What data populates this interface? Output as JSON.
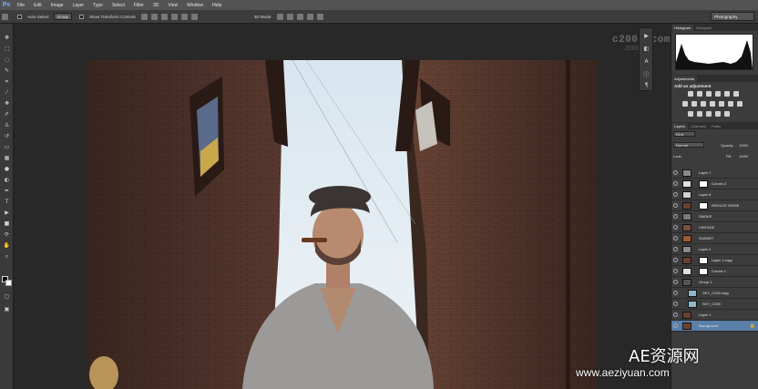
{
  "app": {
    "logo": "Ps",
    "menu": [
      "File",
      "Edit",
      "Image",
      "Layer",
      "Type",
      "Select",
      "Filter",
      "3D",
      "View",
      "Window",
      "Help"
    ]
  },
  "options": {
    "auto_select": "Auto-Select:",
    "group": "Group",
    "transform": "Show Transform Controls",
    "mode3d": "3D Mode:",
    "workspace": "Photography"
  },
  "watermark": {
    "line1": "c2000.com",
    "line2": "2000.net",
    "brand": "AE资源网",
    "url": "www.aeziyuan.com"
  },
  "panels": {
    "histogram_tab": "Histogram",
    "navigator_tab": "Navigator",
    "adjustments_tab": "Adjustments",
    "adjust_title": "Add an adjustment",
    "layers_tab": "Layers",
    "channels_tab": "Channels",
    "paths_tab": "Paths",
    "kind": "Kind",
    "blend": "Normal",
    "opacity_label": "Opacity:",
    "opacity_value": "100%",
    "lock_label": "Lock:",
    "fill_label": "Fill:",
    "fill_value": "100%"
  },
  "layers": [
    {
      "name": "Layer 7",
      "mask": false,
      "thumb": "#8a8a8a"
    },
    {
      "name": "Curves 2",
      "mask": true,
      "thumb": "#e0e0e0"
    },
    {
      "name": "Layer 6",
      "mask": false,
      "thumb": "#d0d0d0"
    },
    {
      "name": "REDUCE NOISE",
      "mask": true,
      "thumb": "#6b4030"
    },
    {
      "name": "SMOKE",
      "mask": false,
      "thumb": "#7a7a7a"
    },
    {
      "name": "VINTAGE",
      "mask": false,
      "thumb": "#7a5040"
    },
    {
      "name": "SUNSET",
      "mask": false,
      "thumb": "#a05a30"
    },
    {
      "name": "Layer 2",
      "mask": false,
      "thumb": "#8a8a8a"
    },
    {
      "name": "Layer 1 copy",
      "mask": true,
      "thumb": "#6b4030"
    },
    {
      "name": "Curves 1",
      "mask": true,
      "thumb": "#e0e0e0"
    },
    {
      "name": "Group 1",
      "mask": false,
      "thumb": "#555"
    },
    {
      "name": "SKY_COM copy",
      "mask": false,
      "thumb": "#8fb7c9"
    },
    {
      "name": "SKY_COM",
      "mask": false,
      "thumb": "#8fb7c9"
    },
    {
      "name": "Layer 1",
      "mask": false,
      "thumb": "#6b4030"
    },
    {
      "name": "Background",
      "mask": false,
      "thumb": "#6b4030"
    }
  ],
  "colors": {
    "accent": "#5a7fa8",
    "panel": "#3c3c3c"
  }
}
